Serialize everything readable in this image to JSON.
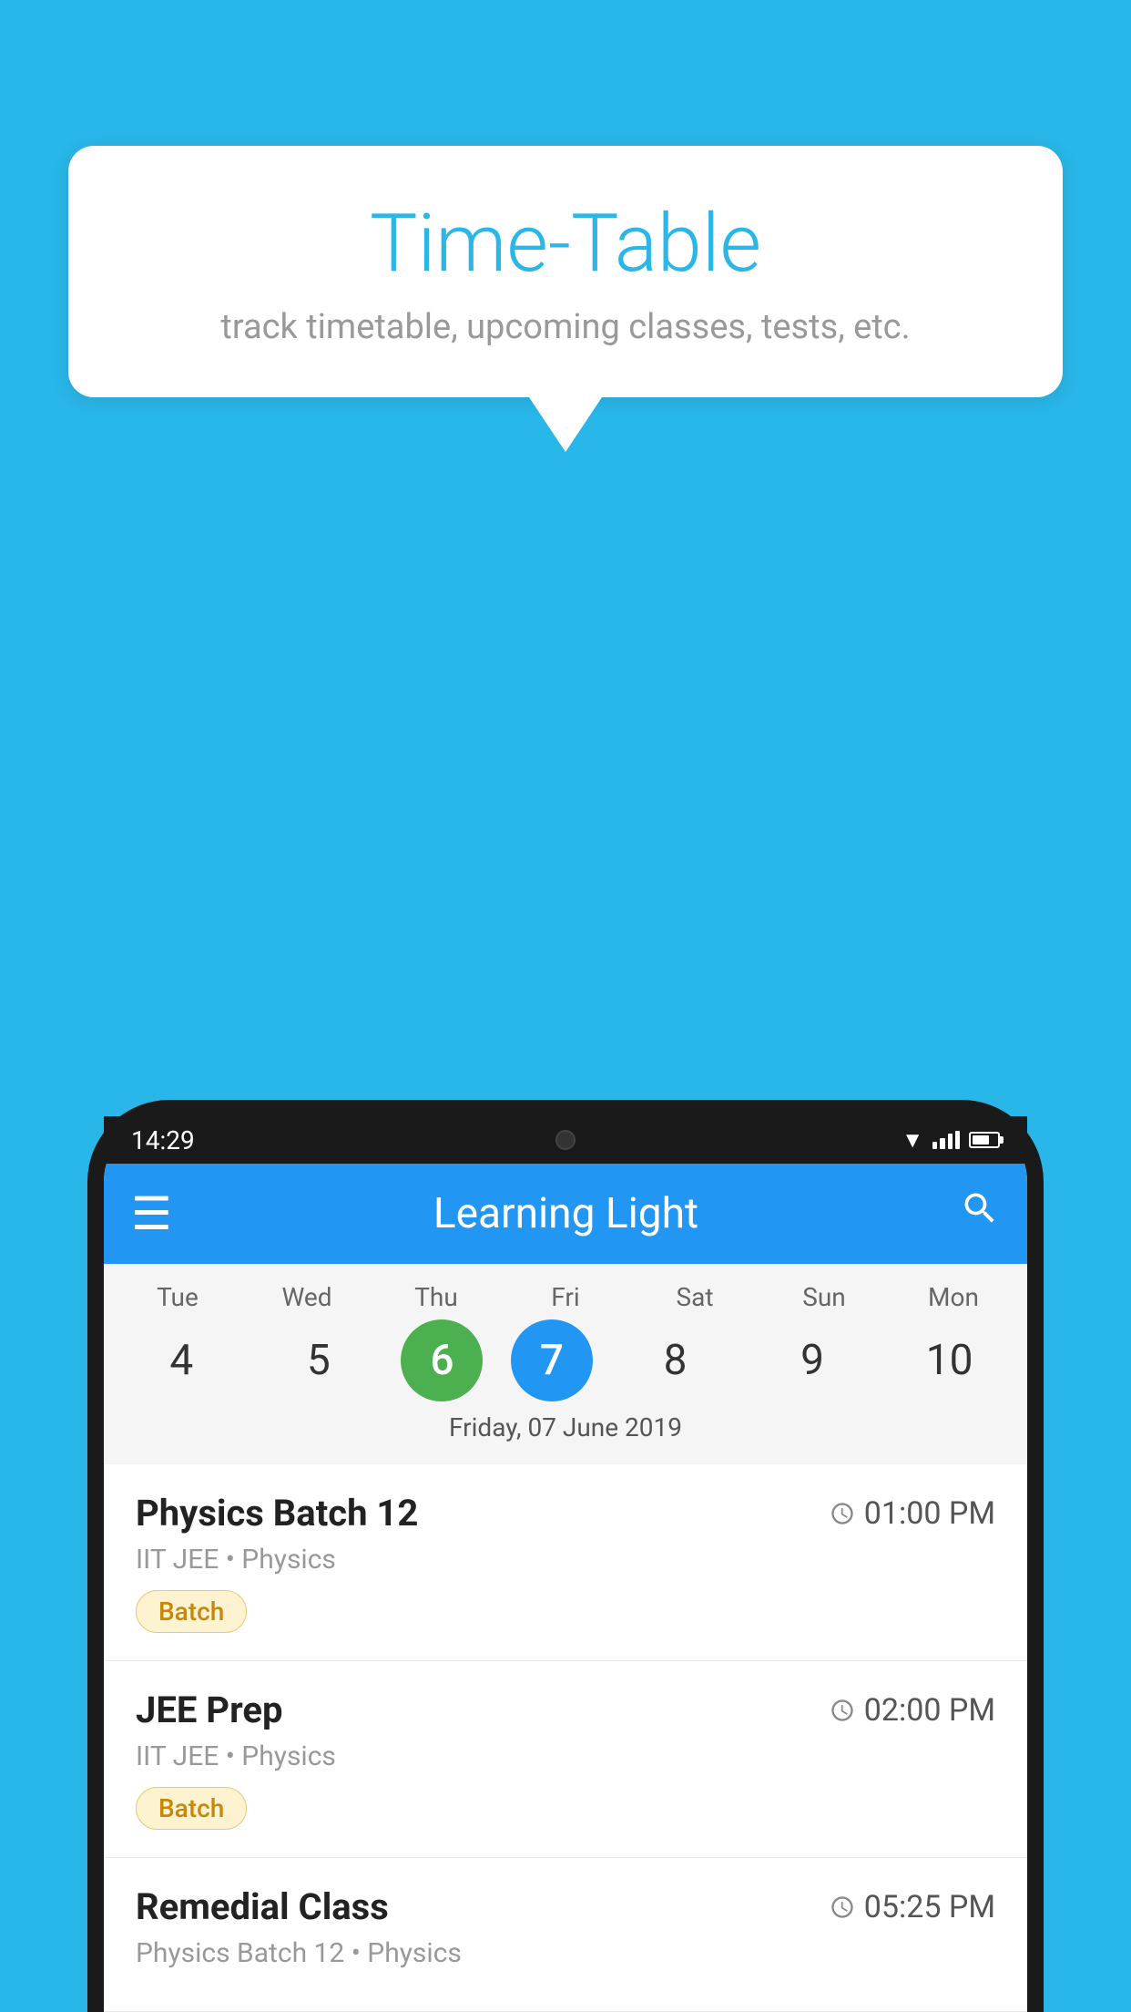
{
  "background_color": "#29b6e8",
  "speech_bubble": {
    "title": "Time-Table",
    "subtitle": "track timetable, upcoming classes, tests, etc."
  },
  "phone": {
    "status_bar": {
      "time": "14:29"
    },
    "app_bar": {
      "title": "Learning Light",
      "menu_icon": "≡",
      "search_icon": "🔍"
    },
    "calendar": {
      "days": [
        {
          "label": "Tue",
          "number": "4"
        },
        {
          "label": "Wed",
          "number": "5"
        },
        {
          "label": "Thu",
          "number": "6",
          "state": "today"
        },
        {
          "label": "Fri",
          "number": "7",
          "state": "selected"
        },
        {
          "label": "Sat",
          "number": "8"
        },
        {
          "label": "Sun",
          "number": "9"
        },
        {
          "label": "Mon",
          "number": "10"
        }
      ],
      "selected_date_label": "Friday, 07 June 2019"
    },
    "schedule": [
      {
        "title": "Physics Batch 12",
        "time": "01:00 PM",
        "subtitle": "IIT JEE • Physics",
        "badge": "Batch"
      },
      {
        "title": "JEE Prep",
        "time": "02:00 PM",
        "subtitle": "IIT JEE • Physics",
        "badge": "Batch"
      },
      {
        "title": "Remedial Class",
        "time": "05:25 PM",
        "subtitle": "Physics Batch 12 • Physics",
        "badge": null
      }
    ]
  }
}
